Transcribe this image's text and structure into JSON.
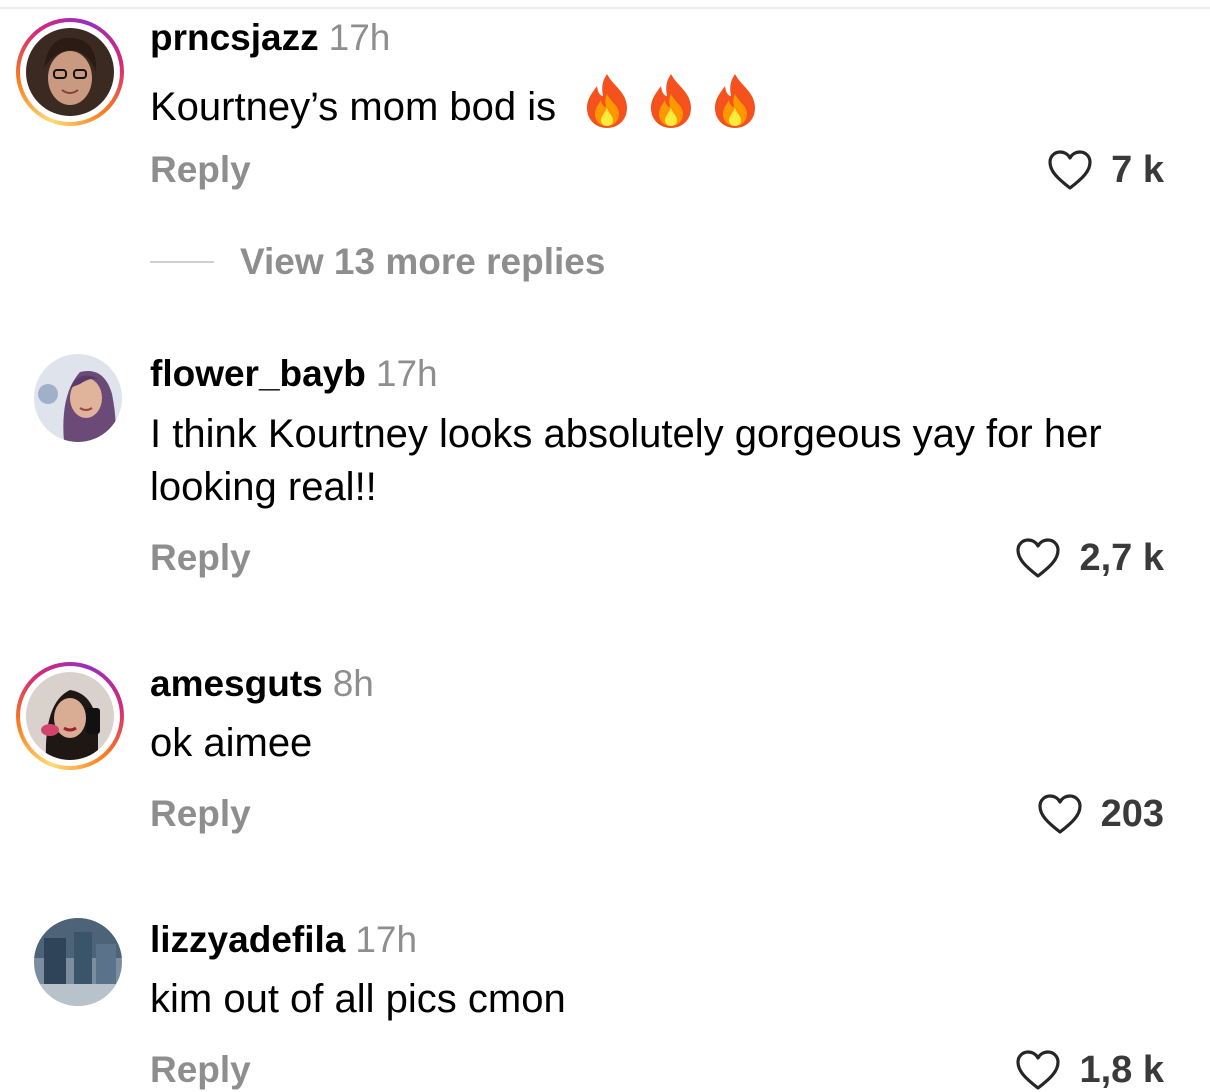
{
  "comments": [
    {
      "username": "prncsjazz",
      "time": "17h",
      "text": "Kourtney’s mom bod is",
      "emoji": [
        "fire-emoji",
        "fire-emoji",
        "fire-emoji"
      ],
      "reply_label": "Reply",
      "likes": "7 k",
      "has_story_ring": true,
      "view_more": "View 13 more replies"
    },
    {
      "username": "flower_bayb",
      "time": "17h",
      "text": "I think Kourtney looks absolutely gorgeous yay for her looking real!!",
      "reply_label": "Reply",
      "likes": "2,7 k",
      "has_story_ring": false
    },
    {
      "username": "amesguts",
      "time": "8h",
      "text": "ok aimee",
      "reply_label": "Reply",
      "likes": "203",
      "has_story_ring": true
    },
    {
      "username": "lizzyadefila",
      "time": "17h",
      "text": "kim out of all pics cmon",
      "reply_label": "Reply",
      "likes": "1,8 k",
      "has_story_ring": false
    }
  ],
  "icons": {
    "like": "heart-outline-icon",
    "emoji": "fire-emoji"
  },
  "colors": {
    "secondary_text": "#8e8e8e",
    "like_count": "#3a3a3a",
    "story_ring_start": "#feda75",
    "story_ring_end": "#962fbf"
  }
}
